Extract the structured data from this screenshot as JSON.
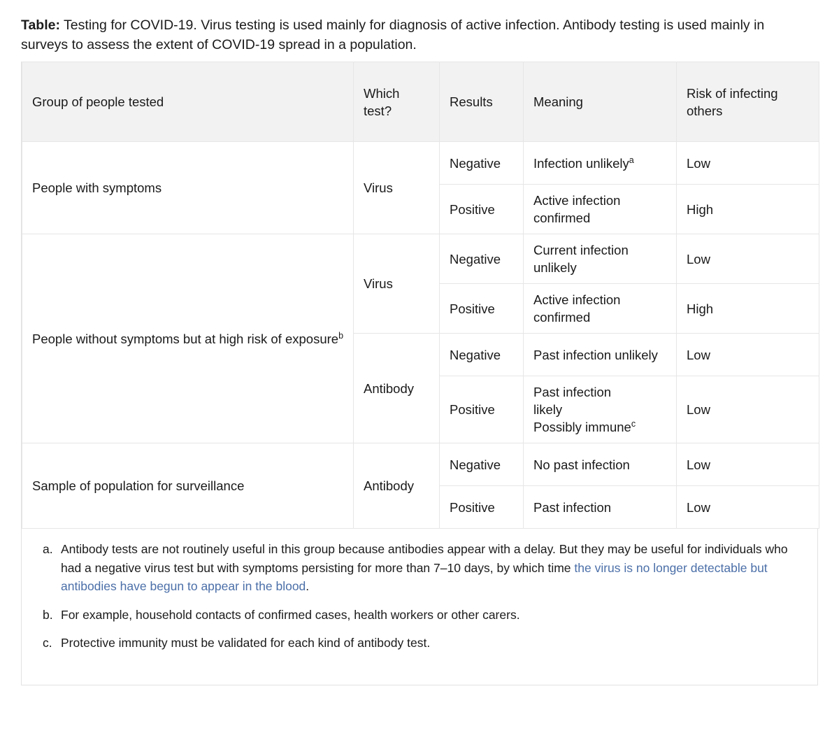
{
  "caption": {
    "lead": "Table:",
    "text": " Testing for COVID-19. Virus testing is used mainly for diagnosis of active infection. Antibody testing is used mainly in surveys to assess the extent of COVID-19 spread in a population."
  },
  "table": {
    "headers": [
      "Group of people tested",
      "Which test?",
      "Results",
      "Meaning",
      "Risk of infecting others"
    ],
    "groups": [
      {
        "group_label": "People with symptoms",
        "group_sup": "",
        "tests": [
          {
            "test": "Virus",
            "rows": [
              {
                "result": "Negative",
                "meaning_line1": "Infection unlikely",
                "meaning_sup": "a",
                "meaning_line2": "",
                "meaning_line3": "",
                "risk": "Low"
              },
              {
                "result": "Positive",
                "meaning_line1": "Active infection confirmed",
                "meaning_sup": "",
                "meaning_line2": "",
                "meaning_line3": "",
                "risk": "High"
              }
            ]
          }
        ]
      },
      {
        "group_label": "People without symptoms but at high risk of exposure",
        "group_sup": "b",
        "tests": [
          {
            "test": "Virus",
            "rows": [
              {
                "result": "Negative",
                "meaning_line1": "Current infection unlikely",
                "meaning_sup": "",
                "meaning_line2": "",
                "meaning_line3": "",
                "risk": "Low"
              },
              {
                "result": "Positive",
                "meaning_line1": "Active infection confirmed",
                "meaning_sup": "",
                "meaning_line2": "",
                "meaning_line3": "",
                "risk": "High"
              }
            ]
          },
          {
            "test": "Antibody",
            "rows": [
              {
                "result": "Negative",
                "meaning_line1": "Past infection unlikely",
                "meaning_sup": "",
                "meaning_line2": "",
                "meaning_line3": "",
                "risk": "Low"
              },
              {
                "result": "Positive",
                "meaning_line1": "Past infection",
                "meaning_sup": "",
                "meaning_line2": "likely",
                "meaning_line3": "Possibly immune",
                "meaning_line3_sup": "c",
                "risk": "Low"
              }
            ]
          }
        ]
      },
      {
        "group_label": "Sample of population for surveillance",
        "group_sup": "",
        "tests": [
          {
            "test": "Antibody",
            "rows": [
              {
                "result": "Negative",
                "meaning_line1": "No past infection",
                "meaning_sup": "",
                "meaning_line2": "",
                "meaning_line3": "",
                "risk": "Low"
              },
              {
                "result": "Positive",
                "meaning_line1": "Past infection",
                "meaning_sup": "",
                "meaning_line2": "",
                "meaning_line3": "",
                "risk": "Low"
              }
            ]
          }
        ]
      }
    ]
  },
  "footnotes": [
    {
      "marker": "a.",
      "text_black": "Antibody tests are not routinely useful in this group because antibodies appear with a delay. But they may be useful for individuals who had a negative virus test but with symptoms persisting for more than 7–10 days, by which time ",
      "text_blue": "the virus is no longer detectable but antibodies have begun to appear in the blood",
      "text_tail": "."
    },
    {
      "marker": "b.",
      "text_black": "For example, household contacts of confirmed cases, health workers or other carers.",
      "text_blue": "",
      "text_tail": ""
    },
    {
      "marker": "c.",
      "text_black": "Protective immunity must be validated for each kind of antibody test.",
      "text_blue": "",
      "text_tail": ""
    }
  ]
}
